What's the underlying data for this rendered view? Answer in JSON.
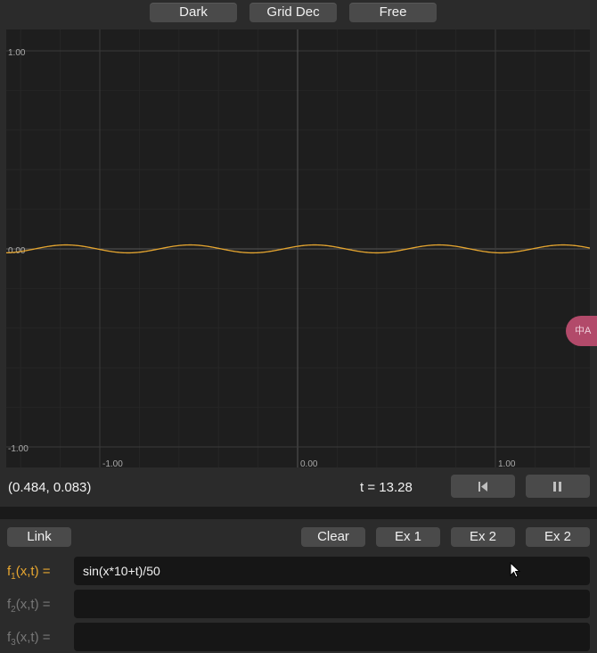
{
  "toolbar": {
    "theme_label": "Dark",
    "grid_label": "Grid Dec",
    "mode_label": "Free"
  },
  "plot": {
    "y_ticks": [
      "1.00",
      "0.00",
      "-1.00"
    ],
    "x_ticks": [
      "-1.00",
      "0.00",
      "1.00"
    ],
    "curve_color": "#e6a630"
  },
  "chart_data": {
    "type": "line",
    "function": "sin(x*10+t)/50",
    "t": 13.28,
    "xlim": [
      -1.48,
      1.48
    ],
    "ylim": [
      -1.1,
      1.0
    ],
    "grid": true
  },
  "status": {
    "coords": "(0.484, 0.083)",
    "time": "t = 13.28"
  },
  "controls": {
    "link_label": "Link",
    "clear_label": "Clear",
    "ex1_label": "Ex 1",
    "ex2_label": "Ex 2",
    "ex2b_label": "Ex 2"
  },
  "functions": [
    {
      "name": "f",
      "index": "1",
      "args": "(x,t) =",
      "value": "sin(x*10+t)/50",
      "color": "#e6a630"
    },
    {
      "name": "f",
      "index": "2",
      "args": "(x,t) =",
      "value": "",
      "color": "#777777"
    },
    {
      "name": "f",
      "index": "3",
      "args": "(x,t) =",
      "value": "",
      "color": "#777777"
    }
  ],
  "translate": {
    "label": "中A"
  }
}
